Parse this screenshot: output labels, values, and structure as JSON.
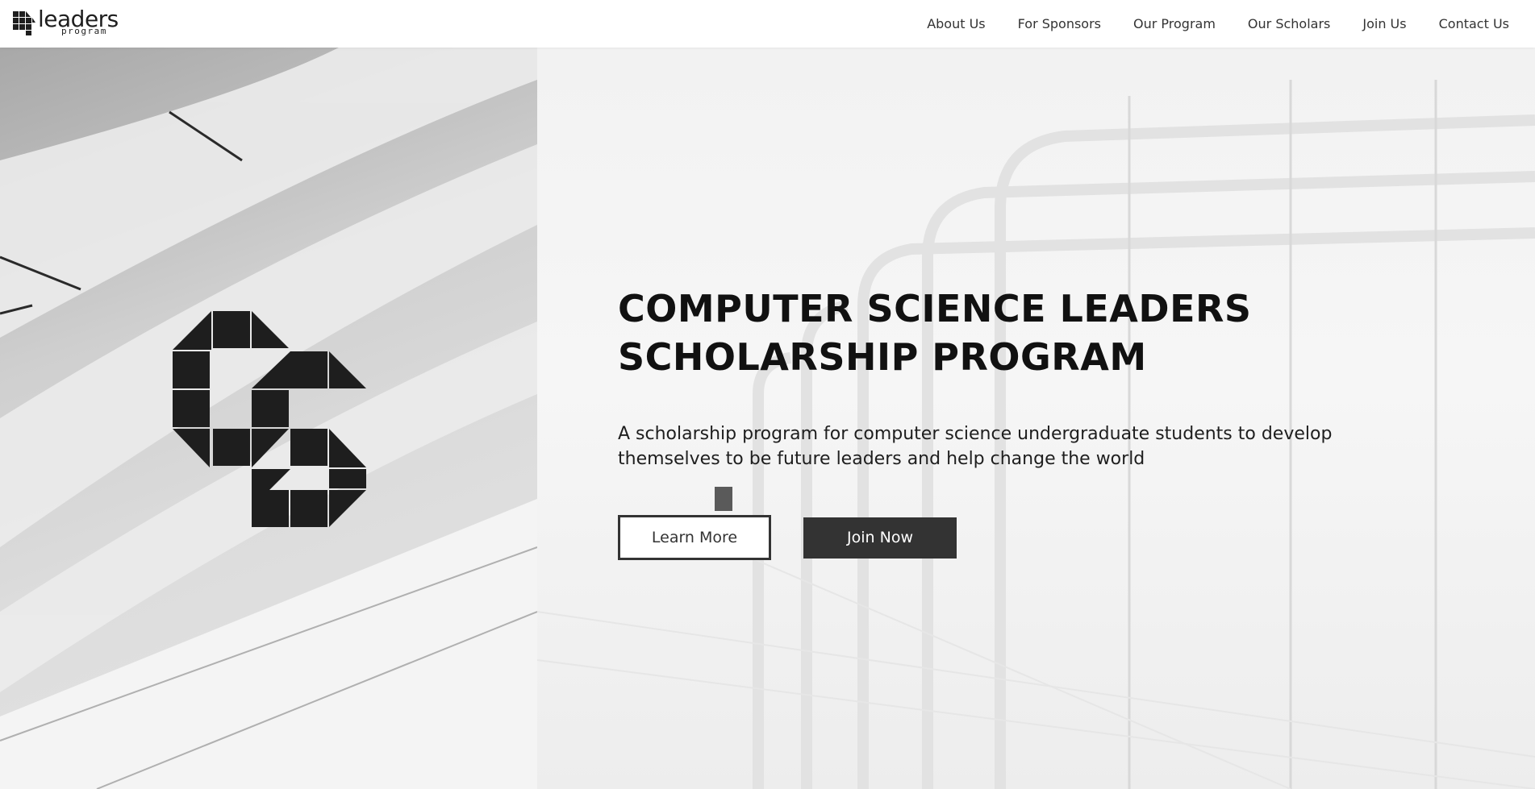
{
  "brand": {
    "logo_word": "leaders",
    "logo_sub": "program",
    "accent": "#333333",
    "icon": "cs-logo-icon"
  },
  "nav": {
    "items": [
      {
        "label": "About Us"
      },
      {
        "label": "For Sponsors"
      },
      {
        "label": "Our Program"
      },
      {
        "label": "Our Scholars"
      },
      {
        "label": "Join Us"
      },
      {
        "label": "Contact Us"
      }
    ]
  },
  "hero": {
    "title": "COMPUTER SCIENCE LEADERS SCHOLARSHIP PROGRAM",
    "subtitle": "A scholarship program for computer science undergraduate students to develop themselves to be future leaders and help change the world",
    "primary_button": "Learn More",
    "secondary_button": "Join Now",
    "background": "architecture-photo",
    "logo_icon": "cs-logo-icon"
  }
}
